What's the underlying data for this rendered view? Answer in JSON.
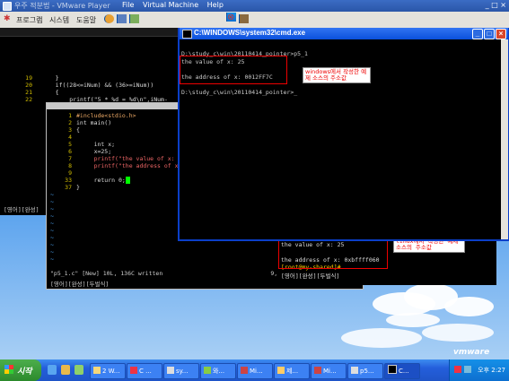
{
  "vmware": {
    "title": "우주 적분법 - VMware Player",
    "menus": [
      "File",
      "Virtual Machine",
      "Help"
    ],
    "logo": "vmware"
  },
  "guest_panel": {
    "menu_items": [
      "프로그램",
      "시스템",
      "도움말"
    ]
  },
  "back_terminal": {
    "lines": [
      {
        "num": "19",
        "text": "    }"
      },
      {
        "num": "20",
        "text": "    if((28<=iNum) && (36>=iNum))"
      },
      {
        "num": "21",
        "text": "    {"
      },
      {
        "num": "22",
        "text": "        printf(\"5 * %d = %d\\n\",iNum-"
      }
    ],
    "status": "[영어][완성]"
  },
  "vim": {
    "lines": [
      {
        "num": "1",
        "text": "#include<stdio.h>"
      },
      {
        "num": "2",
        "text": "int main()"
      },
      {
        "num": "3",
        "text": "{"
      },
      {
        "num": "4",
        "text": ""
      },
      {
        "num": "5",
        "text": "     int x;"
      },
      {
        "num": "6",
        "text": "     x=25;"
      },
      {
        "num": "7",
        "text": "     printf(\"the value of x: %"
      },
      {
        "num": "8",
        "text": "     printf(\"the address of x:"
      },
      {
        "num": "9",
        "text": ""
      },
      {
        "num": "33",
        "text": "     return 0;"
      },
      {
        "num": "37",
        "text": "}"
      }
    ],
    "message": "\"p5_1.c\" [New] 10L, 136C written",
    "position": "9,10",
    "ime": "[영어][완성][두벌식]"
  },
  "linux_output": {
    "line1": "the value of x: 25",
    "line2": "the address of x: 0xbffff060",
    "line3": "[root@my-shared]#",
    "ime": "[영어][완성][두벌식]",
    "note": "linux에서 작성한 예제 소스의 주소값"
  },
  "cmd": {
    "title": "C:\\WINDOWS\\system32\\cmd.exe",
    "line1": "D:\\study_c\\win\\20110414_pointer>p5_1",
    "line2": "the value of x: 25",
    "line3": "the address of x: 0012FF7C",
    "line4": "D:\\study_c\\win\\20110414_pointer>_",
    "note": "windows에서 작성한 예제 소스의 주소값"
  },
  "taskbar": {
    "start_label": "시작",
    "tasks": [
      "2 W...",
      "C ...",
      "sy...",
      "와...",
      "Mi...",
      "제...",
      "Mi...",
      "p5...",
      "C..."
    ],
    "clock": "오후 2:27"
  }
}
